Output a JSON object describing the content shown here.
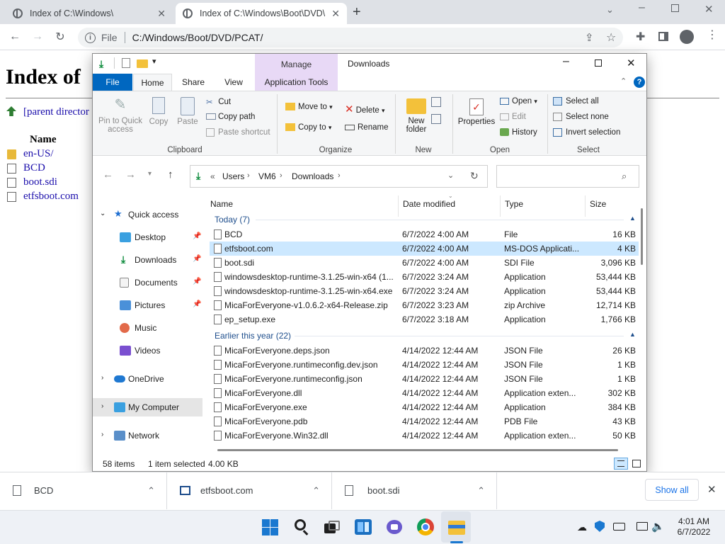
{
  "browser": {
    "tabs": [
      {
        "title": "Index of C:\\Windows\\"
      },
      {
        "title": "Index of C:\\Windows\\Boot\\DVD\\"
      }
    ],
    "address_scheme": "File",
    "address": "C:/Windows/Boot/DVD/PCAT/"
  },
  "page": {
    "title": "Index of",
    "parent_link": "[parent director",
    "name_header": "Name",
    "items": [
      "en-US/",
      "BCD",
      "boot.sdi",
      "etfsboot.com"
    ]
  },
  "explorer": {
    "title": "Downloads",
    "context_tab": "Manage",
    "tabs": [
      "File",
      "Home",
      "Share",
      "View",
      "Application Tools"
    ],
    "ribbon": {
      "pin_label1": "Pin to Quick",
      "pin_label2": "access",
      "copy": "Copy",
      "paste": "Paste",
      "cut": "Cut",
      "copy_path": "Copy path",
      "paste_shortcut": "Paste shortcut",
      "move_to": "Move to",
      "copy_to": "Copy to",
      "delete": "Delete",
      "rename": "Rename",
      "new_folder1": "New",
      "new_folder2": "folder",
      "properties": "Properties",
      "open": "Open",
      "edit": "Edit",
      "history": "History",
      "select_all": "Select all",
      "select_none": "Select none",
      "invert_selection": "Invert selection",
      "groups": {
        "clipboard": "Clipboard",
        "organize": "Organize",
        "new": "New",
        "open": "Open",
        "select": "Select"
      }
    },
    "breadcrumb": {
      "prefix": "«",
      "parts": [
        "Users",
        "VM6",
        "Downloads"
      ]
    },
    "columns": {
      "name": "Name",
      "date": "Date modified",
      "type": "Type",
      "size": "Size"
    },
    "groups": [
      {
        "label": "Today (7)"
      },
      {
        "label": "Earlier this year (22)"
      }
    ],
    "files_today": [
      {
        "name": "BCD",
        "date": "6/7/2022 4:00 AM",
        "type": "File",
        "size": "16 KB"
      },
      {
        "name": "etfsboot.com",
        "date": "6/7/2022 4:00 AM",
        "type": "MS-DOS Applicati...",
        "size": "4 KB"
      },
      {
        "name": "boot.sdi",
        "date": "6/7/2022 4:00 AM",
        "type": "SDI File",
        "size": "3,096 KB"
      },
      {
        "name": "windowsdesktop-runtime-3.1.25-win-x64 (1...",
        "date": "6/7/2022 3:24 AM",
        "type": "Application",
        "size": "53,444 KB"
      },
      {
        "name": "windowsdesktop-runtime-3.1.25-win-x64.exe",
        "date": "6/7/2022 3:24 AM",
        "type": "Application",
        "size": "53,444 KB"
      },
      {
        "name": "MicaForEveryone-v1.0.6.2-x64-Release.zip",
        "date": "6/7/2022 3:23 AM",
        "type": "zip Archive",
        "size": "12,714 KB"
      },
      {
        "name": "ep_setup.exe",
        "date": "6/7/2022 3:18 AM",
        "type": "Application",
        "size": "1,766 KB"
      }
    ],
    "files_earlier": [
      {
        "name": "MicaForEveryone.deps.json",
        "date": "4/14/2022 12:44 AM",
        "type": "JSON File",
        "size": "26 KB"
      },
      {
        "name": "MicaForEveryone.runtimeconfig.dev.json",
        "date": "4/14/2022 12:44 AM",
        "type": "JSON File",
        "size": "1 KB"
      },
      {
        "name": "MicaForEveryone.runtimeconfig.json",
        "date": "4/14/2022 12:44 AM",
        "type": "JSON File",
        "size": "1 KB"
      },
      {
        "name": "MicaForEveryone.dll",
        "date": "4/14/2022 12:44 AM",
        "type": "Application exten...",
        "size": "302 KB"
      },
      {
        "name": "MicaForEveryone.exe",
        "date": "4/14/2022 12:44 AM",
        "type": "Application",
        "size": "384 KB"
      },
      {
        "name": "MicaForEveryone.pdb",
        "date": "4/14/2022 12:44 AM",
        "type": "PDB File",
        "size": "43 KB"
      },
      {
        "name": "MicaForEveryone.Win32.dll",
        "date": "4/14/2022 12:44 AM",
        "type": "Application exten...",
        "size": "50 KB"
      }
    ],
    "nav": {
      "quick_access": "Quick access",
      "desktop": "Desktop",
      "downloads": "Downloads",
      "documents": "Documents",
      "pictures": "Pictures",
      "music": "Music",
      "videos": "Videos",
      "onedrive": "OneDrive",
      "my_computer": "My Computer",
      "network": "Network"
    },
    "status": {
      "count": "58 items",
      "selected": "1 item selected",
      "size": "4.00 KB"
    }
  },
  "downloads_bar": {
    "items": [
      "BCD",
      "etfsboot.com",
      "boot.sdi"
    ],
    "show_all": "Show all"
  },
  "taskbar": {
    "time": "4:01 AM",
    "date": "6/7/2022"
  },
  "colors": {
    "accent": "#0067c0",
    "selection": "#cce8ff",
    "manage_tab": "#e8d9f6"
  }
}
